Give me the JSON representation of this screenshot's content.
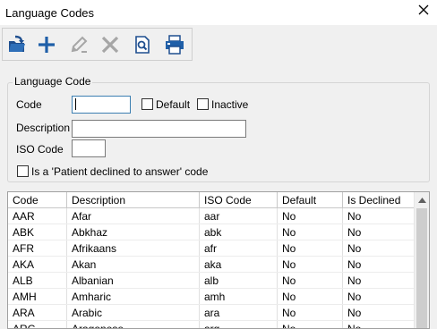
{
  "window": {
    "title": "Language Codes"
  },
  "toolbar": {
    "buttons": [
      {
        "name": "open-record",
        "icon": "folder-arrow-icon",
        "enabled": true
      },
      {
        "name": "add",
        "icon": "plus-icon",
        "enabled": true
      },
      {
        "name": "edit",
        "icon": "pencil-icon",
        "enabled": false
      },
      {
        "name": "delete",
        "icon": "x-icon",
        "enabled": false
      },
      {
        "name": "preview",
        "icon": "magnifier-page-icon",
        "enabled": true
      },
      {
        "name": "print",
        "icon": "printer-icon",
        "enabled": true
      }
    ]
  },
  "form": {
    "group_title": "Language Code",
    "code_label": "Code",
    "code_value": "",
    "default_label": "Default",
    "inactive_label": "Inactive",
    "description_label": "Description",
    "description_value": "",
    "iso_label": "ISO Code",
    "iso_value": "",
    "declined_label": "Is a 'Patient declined to answer' code"
  },
  "grid": {
    "columns": [
      "Code",
      "Description",
      "ISO Code",
      "Default",
      "Is Declined"
    ],
    "rows": [
      [
        "AAR",
        "Afar",
        "aar",
        "No",
        "No"
      ],
      [
        "ABK",
        "Abkhaz",
        "abk",
        "No",
        "No"
      ],
      [
        "AFR",
        "Afrikaans",
        "afr",
        "No",
        "No"
      ],
      [
        "AKA",
        "Akan",
        "aka",
        "No",
        "No"
      ],
      [
        "ALB",
        "Albanian",
        "alb",
        "No",
        "No"
      ],
      [
        "AMH",
        "Amharic",
        "amh",
        "No",
        "No"
      ],
      [
        "ARA",
        "Arabic",
        "ara",
        "No",
        "No"
      ],
      [
        "ARG",
        "Aragonese",
        "arg",
        "No",
        "No"
      ]
    ]
  },
  "colors": {
    "accent_blue": "#1f5fa8",
    "disabled_gray": "#a6a6a6",
    "grid_border": "#a0a0a0"
  }
}
